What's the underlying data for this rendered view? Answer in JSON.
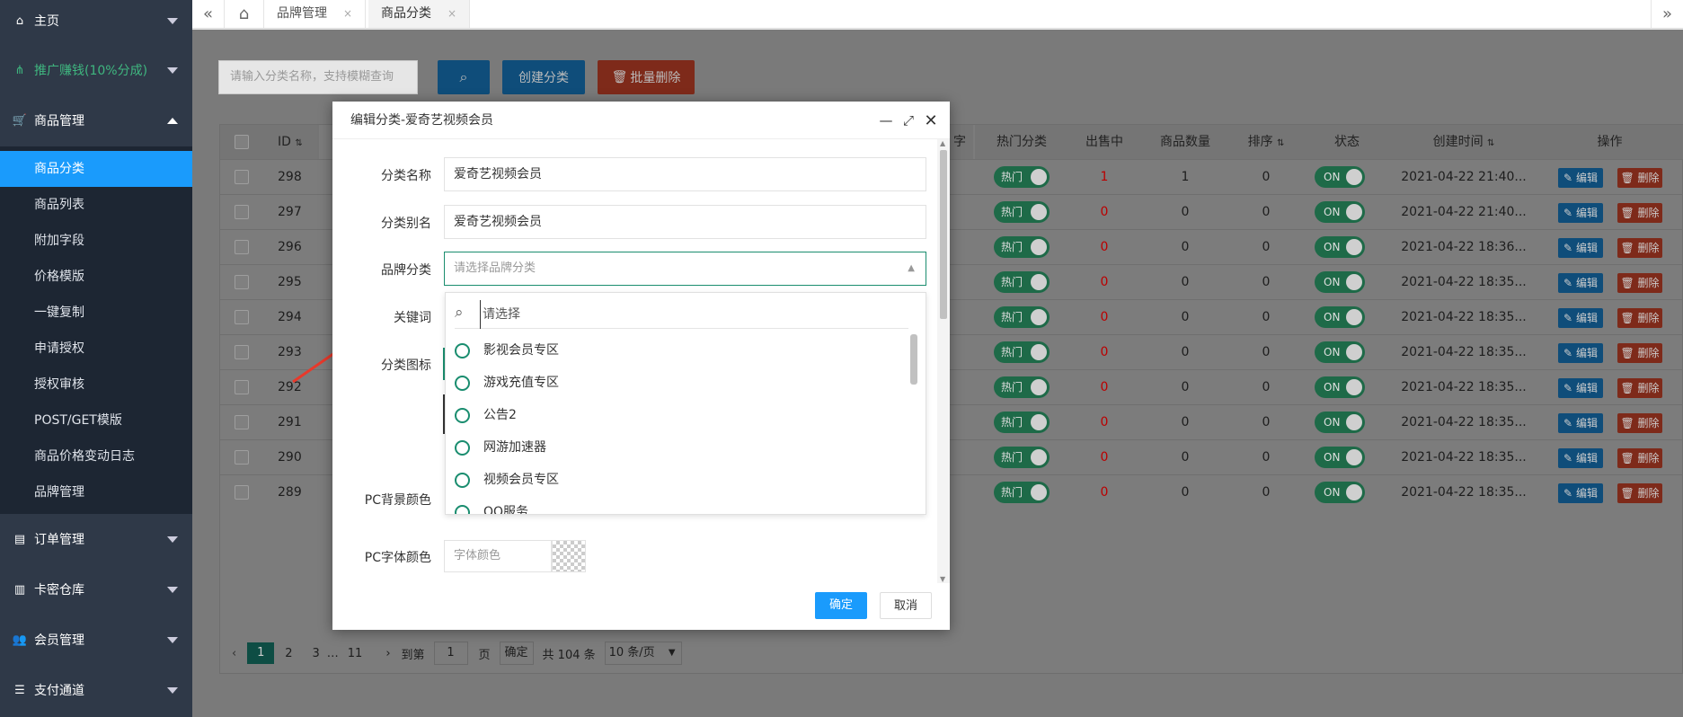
{
  "sidebar": {
    "items": [
      {
        "label": "主页",
        "icon": "home-icon"
      },
      {
        "label": "推广赚钱(10%分成)",
        "icon": "sitemap-icon",
        "color": "#3fb67f"
      },
      {
        "label": "商品管理",
        "icon": "cart-icon",
        "expanded": true
      },
      {
        "label": "订单管理",
        "icon": "clipboard-icon"
      },
      {
        "label": "卡密仓库",
        "icon": "bank-icon"
      },
      {
        "label": "会员管理",
        "icon": "users-icon"
      },
      {
        "label": "支付通道",
        "icon": "list-icon"
      }
    ],
    "submenu": [
      "商品分类",
      "商品列表",
      "附加字段",
      "价格模版",
      "一键复制",
      "申请授权",
      "授权审核",
      "POST/GET模版",
      "商品价格变动日志",
      "品牌管理"
    ],
    "active_submenu": "商品分类"
  },
  "topbar": {
    "tabs": [
      {
        "label": "品牌管理",
        "close": "×"
      },
      {
        "label": "商品分类",
        "close": "×"
      }
    ]
  },
  "toolbar": {
    "search_placeholder": "请输入分类名称，支持模糊查询",
    "create_label": "创建分类",
    "batch_delete_label": "批量删除",
    "primary_color": "#1a9bfc",
    "danger_color": "#e8541e"
  },
  "table": {
    "headers": [
      "ID",
      "字",
      "热门分类",
      "出售中",
      "商品数量",
      "排序",
      "状态",
      "创建时间",
      "操作"
    ],
    "rows": [
      {
        "id": "298",
        "hot": "热门",
        "on_sale": "1",
        "count": "1",
        "sort": "0",
        "status": "ON",
        "created": "2021-04-22 21:40..."
      },
      {
        "id": "297",
        "hot": "热门",
        "on_sale": "0",
        "count": "0",
        "sort": "0",
        "status": "ON",
        "created": "2021-04-22 21:40..."
      },
      {
        "id": "296",
        "hot": "热门",
        "on_sale": "0",
        "count": "0",
        "sort": "0",
        "status": "ON",
        "created": "2021-04-22 18:36..."
      },
      {
        "id": "295",
        "hot": "热门",
        "on_sale": "0",
        "count": "0",
        "sort": "0",
        "status": "ON",
        "created": "2021-04-22 18:35..."
      },
      {
        "id": "294",
        "hot": "热门",
        "on_sale": "0",
        "count": "0",
        "sort": "0",
        "status": "ON",
        "created": "2021-04-22 18:35..."
      },
      {
        "id": "293",
        "hot": "热门",
        "on_sale": "0",
        "count": "0",
        "sort": "0",
        "status": "ON",
        "created": "2021-04-22 18:35..."
      },
      {
        "id": "292",
        "hot": "热门",
        "on_sale": "0",
        "count": "0",
        "sort": "0",
        "status": "ON",
        "created": "2021-04-22 18:35..."
      },
      {
        "id": "291",
        "hot": "热门",
        "on_sale": "0",
        "count": "0",
        "sort": "0",
        "status": "ON",
        "created": "2021-04-22 18:35..."
      },
      {
        "id": "290",
        "hot": "热门",
        "on_sale": "0",
        "count": "0",
        "sort": "0",
        "status": "ON",
        "created": "2021-04-22 18:35..."
      },
      {
        "id": "289",
        "hot": "热门",
        "on_sale": "0",
        "count": "0",
        "sort": "0",
        "status": "ON",
        "created": "2021-04-22 18:35..."
      }
    ],
    "edit_label": "编辑",
    "delete_label": "删除"
  },
  "pagination": {
    "pages": [
      "1",
      "2",
      "3",
      "…",
      "11"
    ],
    "current": "1",
    "goto_prefix": "到第",
    "goto_value": "1",
    "goto_suffix": "页",
    "confirm": "确定",
    "total": "共 104 条",
    "per_page": "10 条/页"
  },
  "modal": {
    "title": "编辑分类-爱奇艺视频会员",
    "fields": {
      "name_label": "分类名称",
      "name_value": "爱奇艺视频会员",
      "alias_label": "分类别名",
      "alias_value": "爱奇艺视频会员",
      "brand_label": "品牌分类",
      "brand_placeholder": "请选择品牌分类",
      "keyword_label": "关键词",
      "icon_label": "分类图标",
      "pc_bg_label": "PC背景颜色",
      "pc_font_label": "PC字体颜色",
      "pc_font_placeholder": "字体颜色"
    },
    "dropdown": {
      "search_placeholder": "请选择",
      "options": [
        "影视会员专区",
        "游戏充值专区",
        "公告2",
        "网游加速器",
        "视频会员专区",
        "QQ服务"
      ],
      "accent": "#1a8d6f"
    },
    "ok_label": "确定",
    "cancel_label": "取消"
  }
}
